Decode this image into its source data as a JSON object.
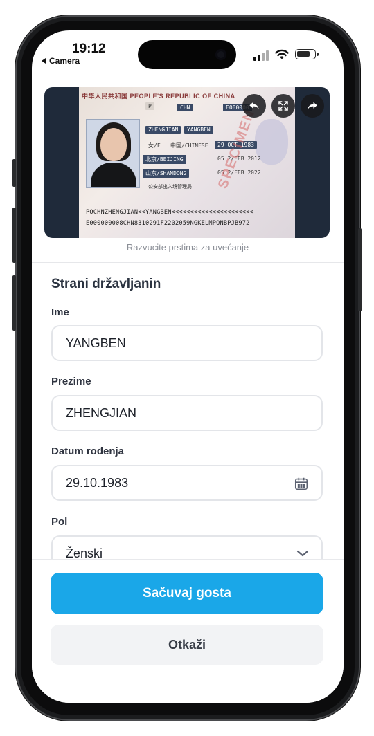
{
  "status_bar": {
    "time": "19:12",
    "back_label": "Camera"
  },
  "document": {
    "header": "中华人民共和国 PEOPLE'S REPUBLIC OF CHINA",
    "type": "P",
    "country": "CHN",
    "number": "E000000",
    "surname": "ZHENGJIAN",
    "given_name": "YANGBEN",
    "sex": "女/F",
    "nationality": "中国/CHINESE",
    "birth_date": "29 OCT 1983",
    "birth_place": "北京/BEIJING",
    "issue_date": "05 2/FEB 2012",
    "issue_place": "山东/SHANDONG",
    "expiry_date": "05 2/FEB 2022",
    "authority": "公安部出入境管理局",
    "specimen": "SPECIMEN",
    "mrz_line1": "POCHNZHENGJIAN<<YANGBEN<<<<<<<<<<<<<<<<<<<<<<",
    "mrz_line2": "E000000008CHN8310291F2202059NGKELMPONBPJB972",
    "hint": "Razvucite prstima za uvećanje"
  },
  "form": {
    "section_title": "Strani državljanin",
    "first_name": {
      "label": "Ime",
      "value": "YANGBEN"
    },
    "last_name": {
      "label": "Prezime",
      "value": "ZHENGJIAN"
    },
    "birth_date": {
      "label": "Datum rođenja",
      "value": "29.10.1983"
    },
    "gender": {
      "label": "Pol",
      "value": "Ženski"
    }
  },
  "actions": {
    "save_label": "Sačuvaj gosta",
    "cancel_label": "Otkaži"
  },
  "colors": {
    "primary": "#1aa7e8",
    "secondary_bg": "#f2f3f5"
  }
}
